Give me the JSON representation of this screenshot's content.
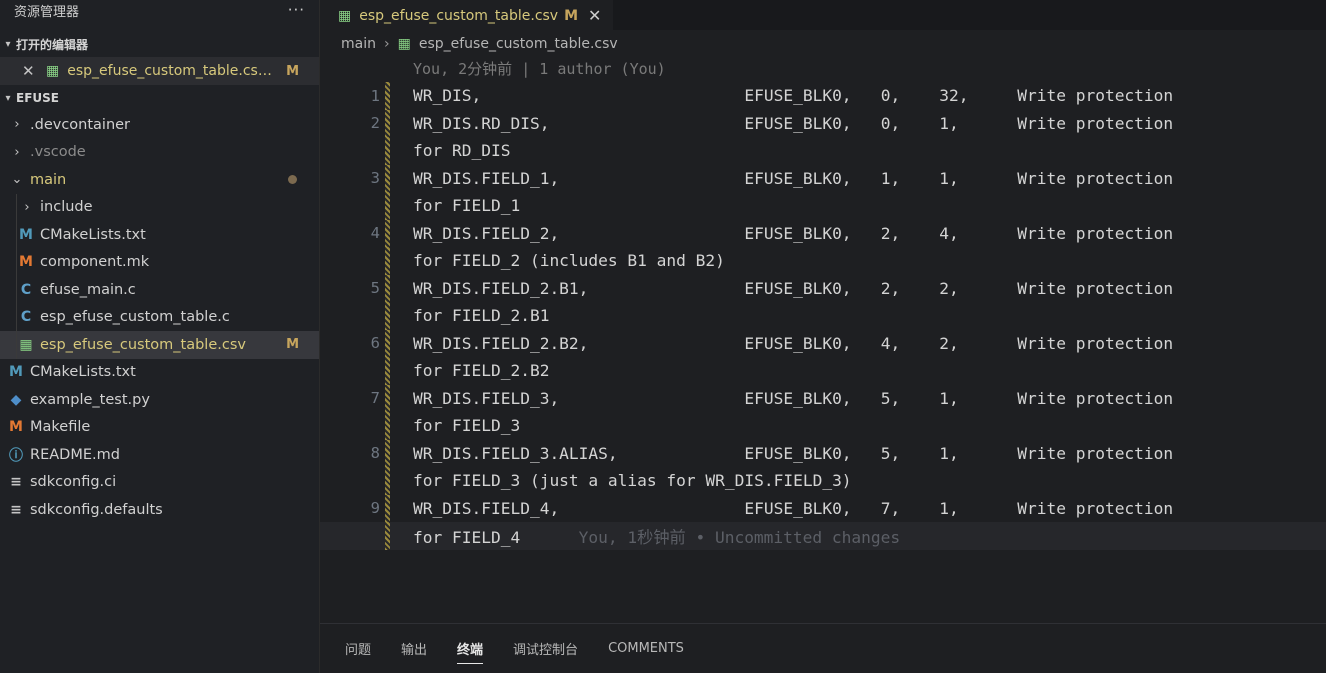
{
  "sidebar": {
    "title": "资源管理器",
    "more": "···",
    "open_editors": {
      "label": "打开的编辑器",
      "items": [
        {
          "name": "esp_efuse_custom_table.csv...",
          "badge": "M",
          "close": "✕",
          "icon": "csv-icon"
        }
      ]
    },
    "project": {
      "label": "EFUSE",
      "items": [
        {
          "label": ".devcontainer",
          "chevron": "›",
          "icon": "folder"
        },
        {
          "label": ".vscode",
          "chevron": "›",
          "icon": "folder"
        },
        {
          "label": "main",
          "chevron": "⌄",
          "icon": "folder"
        },
        {
          "label": "include",
          "chevron": "›",
          "icon": "folder"
        },
        {
          "label": "CMakeLists.txt",
          "icon_char": "M",
          "icon": "cmake-icon"
        },
        {
          "label": "component.mk",
          "icon_char": "M",
          "icon": "makefile-icon"
        },
        {
          "label": "efuse_main.c",
          "icon_char": "C",
          "icon": "c-file-icon"
        },
        {
          "label": "esp_efuse_custom_table.c",
          "icon_char": "C",
          "icon": "c-file-icon"
        },
        {
          "label": "esp_efuse_custom_table.csv",
          "icon_char": "▦",
          "icon": "csv-icon",
          "badge": "M"
        },
        {
          "label": "CMakeLists.txt",
          "icon_char": "M",
          "icon": "cmake-icon"
        },
        {
          "label": "example_test.py",
          "icon_char": "◆",
          "icon": "python-icon"
        },
        {
          "label": "Makefile",
          "icon_char": "M",
          "icon": "makefile-icon"
        },
        {
          "label": "README.md",
          "icon_char": "ⓘ",
          "icon": "info-icon"
        },
        {
          "label": "sdkconfig.ci",
          "icon_char": "≡",
          "icon": "lines-icon"
        },
        {
          "label": "sdkconfig.defaults",
          "icon_char": "≡",
          "icon": "lines-icon"
        }
      ]
    }
  },
  "editor": {
    "tab": {
      "name": "esp_efuse_custom_table.csv",
      "badge": "M",
      "close": "✕",
      "icon_char": "▦"
    },
    "breadcrumb": {
      "folder": "main",
      "sep": "›",
      "file": "esp_efuse_custom_table.csv",
      "icon_char": "▦"
    },
    "blame_header": "You, 2分钟前 | 1 author (You)",
    "lines": [
      {
        "num": "1",
        "text": "WR_DIS,                           EFUSE_BLK0,   0,    32,     Write protection"
      },
      {
        "num": "2",
        "text": "WR_DIS.RD_DIS,                    EFUSE_BLK0,   0,    1,      Write protection"
      },
      {
        "num": "",
        "text": "for RD_DIS"
      },
      {
        "num": "3",
        "text": "WR_DIS.FIELD_1,                   EFUSE_BLK0,   1,    1,      Write protection"
      },
      {
        "num": "",
        "text": "for FIELD_1"
      },
      {
        "num": "4",
        "text": "WR_DIS.FIELD_2,                   EFUSE_BLK0,   2,    4,      Write protection"
      },
      {
        "num": "",
        "text": "for FIELD_2 (includes B1 and B2)"
      },
      {
        "num": "5",
        "text": "WR_DIS.FIELD_2.B1,                EFUSE_BLK0,   2,    2,      Write protection"
      },
      {
        "num": "",
        "text": "for FIELD_2.B1"
      },
      {
        "num": "6",
        "text": "WR_DIS.FIELD_2.B2,                EFUSE_BLK0,   4,    2,      Write protection"
      },
      {
        "num": "",
        "text": "for FIELD_2.B2"
      },
      {
        "num": "7",
        "text": "WR_DIS.FIELD_3,                   EFUSE_BLK0,   5,    1,      Write protection"
      },
      {
        "num": "",
        "text": "for FIELD_3"
      },
      {
        "num": "8",
        "text": "WR_DIS.FIELD_3.ALIAS,             EFUSE_BLK0,   5,    1,      Write protection"
      },
      {
        "num": "",
        "text": "for FIELD_3 (just a alias for WR_DIS.FIELD_3)"
      },
      {
        "num": "9",
        "text": "WR_DIS.FIELD_4,                   EFUSE_BLK0,   7,    1,      Write protection"
      },
      {
        "num": "",
        "text": "for FIELD_4",
        "ghost": "      You, 1秒钟前 • Uncommitted changes"
      }
    ]
  },
  "panel": {
    "tabs": [
      "问题",
      "输出",
      "终端",
      "调试控制台",
      "COMMENTS"
    ],
    "active": "终端"
  }
}
